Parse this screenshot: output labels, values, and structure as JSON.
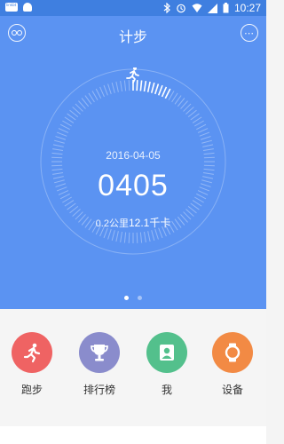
{
  "status": {
    "time": "10:27",
    "app_badge": "linkbt",
    "icons": [
      "bluetooth-icon",
      "alarm-icon",
      "wifi-icon",
      "signal-icon",
      "battery-icon"
    ]
  },
  "header": {
    "title": "计步",
    "more_icon": "more-icon",
    "link_icon": "link-icon"
  },
  "summary": {
    "date": "2016-04-05",
    "steps": "0405",
    "distance": "0.2公里",
    "calories": "12.1千卡",
    "progress": 0.08
  },
  "pager": {
    "count": 2,
    "active": 0
  },
  "colors": {
    "hero": "#5b93f2",
    "status": "#3f7fe0",
    "run": "#ef6363",
    "rank": "#8a8ccc",
    "me": "#53c08c",
    "device": "#f28a44"
  },
  "nav": {
    "items": [
      {
        "label": "跑步",
        "icon": "running-icon"
      },
      {
        "label": "排行榜",
        "icon": "trophy-icon"
      },
      {
        "label": "我",
        "icon": "user-icon"
      },
      {
        "label": "设备",
        "icon": "watch-icon"
      }
    ]
  }
}
